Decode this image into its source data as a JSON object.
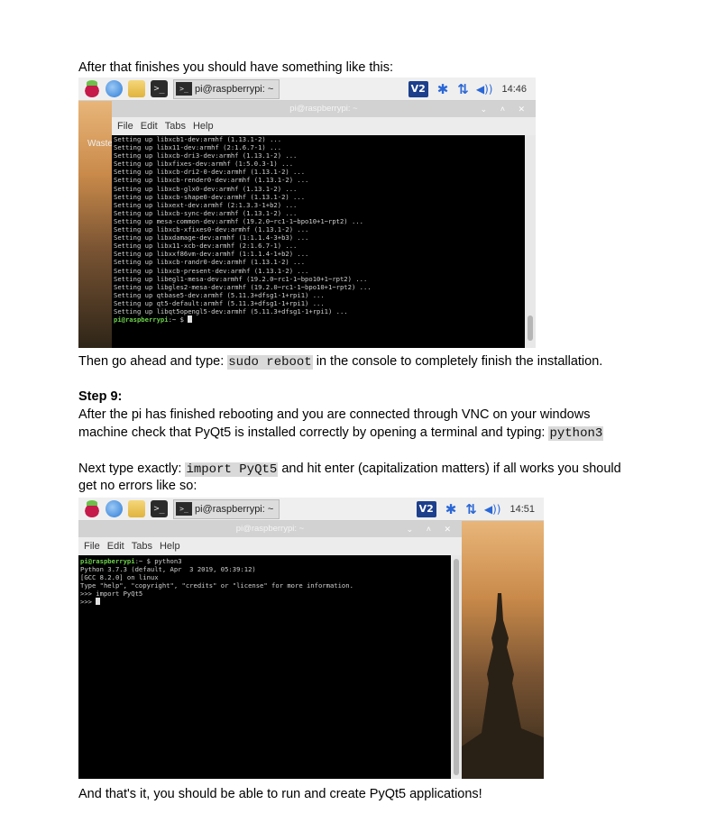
{
  "intro_text": "After that finishes you should have something like this:",
  "shot1": {
    "taskbar_label": "pi@raspberrypi: ~",
    "clock": "14:46",
    "vnc_label": "V2",
    "window_title": "pi@raspberrypi: ~",
    "menu": [
      "File",
      "Edit",
      "Tabs",
      "Help"
    ],
    "desktop_label": "Waste",
    "lines": [
      "Setting up libxcb1-dev:armhf (1.13.1-2) ...",
      "Setting up libx11-dev:armhf (2:1.6.7-1) ...",
      "Setting up libxcb-dri3-dev:armhf (1.13.1-2) ...",
      "Setting up libxfixes-dev:armhf (1:5.0.3-1) ...",
      "Setting up libxcb-dri2-0-dev:armhf (1.13.1-2) ...",
      "Setting up libxcb-render0-dev:armhf (1.13.1-2) ...",
      "Setting up libxcb-glx0-dev:armhf (1.13.1-2) ...",
      "Setting up libxcb-shape0-dev:armhf (1.13.1-2) ...",
      "Setting up libxext-dev:armhf (2:1.3.3-1+b2) ...",
      "Setting up libxcb-sync-dev:armhf (1.13.1-2) ...",
      "Setting up mesa-common-dev:armhf (19.2.0~rc1-1~bpo10+1~rpt2) ...",
      "Setting up libxcb-xfixes0-dev:armhf (1.13.1-2) ...",
      "Setting up libxdamage-dev:armhf (1:1.1.4-3+b3) ...",
      "Setting up libx11-xcb-dev:armhf (2:1.6.7-1) ...",
      "Setting up libxxf86vm-dev:armhf (1:1.1.4-1+b2) ...",
      "Setting up libxcb-randr0-dev:armhf (1.13.1-2) ...",
      "Setting up libxcb-present-dev:armhf (1.13.1-2) ...",
      "Setting up libegl1-mesa-dev:armhf (19.2.0~rc1-1~bpo10+1~rpt2) ...",
      "Setting up libgles2-mesa-dev:armhf (19.2.0~rc1-1~bpo10+1~rpt2) ...",
      "Setting up qtbase5-dev:armhf (5.11.3+dfsg1-1+rpi1) ...",
      "Setting up qt5-default:armhf (5.11.3+dfsg1-1+rpi1) ...",
      "Setting up libqt5opengl5-dev:armhf (5.11.3+dfsg1-1+rpi1) ..."
    ],
    "prompt": "pi@raspberrypi",
    "prompt_tail": ":~ $ "
  },
  "reboot": {
    "before": "Then go ahead and type: ",
    "code": "sudo reboot",
    "after": " in the console to completely finish the installation."
  },
  "step9": {
    "heading": "Step 9:",
    "line1": "After the pi has finished rebooting and you are connected through VNC on your windows",
    "line2_before": "machine check that PyQt5 is installed correctly by opening a terminal and typing: ",
    "line2_code": "python3"
  },
  "next": {
    "before": "Next type exactly: ",
    "code": "import PyQt5",
    "after": " and hit enter (capitalization matters) if all works you should",
    "line2": "get no errors like so:"
  },
  "shot2": {
    "taskbar_label": "pi@raspberrypi: ~",
    "clock": "14:51",
    "vnc_label": "V2",
    "window_title": "pi@raspberrypi: ~",
    "menu": [
      "File",
      "Edit",
      "Tabs",
      "Help"
    ],
    "prompt": "pi@raspberrypi",
    "prompt_tail": ":~ $ python3",
    "lines": [
      "Python 3.7.3 (default, Apr  3 2019, 05:39:12)",
      "[GCC 8.2.0] on linux",
      "Type \"help\", \"copyright\", \"credits\" or \"license\" for more information.",
      ">>> import PyQt5"
    ],
    "last_prompt": ">>> "
  },
  "outro_text": "And that's it, you should be able to run and create PyQt5 applications!"
}
